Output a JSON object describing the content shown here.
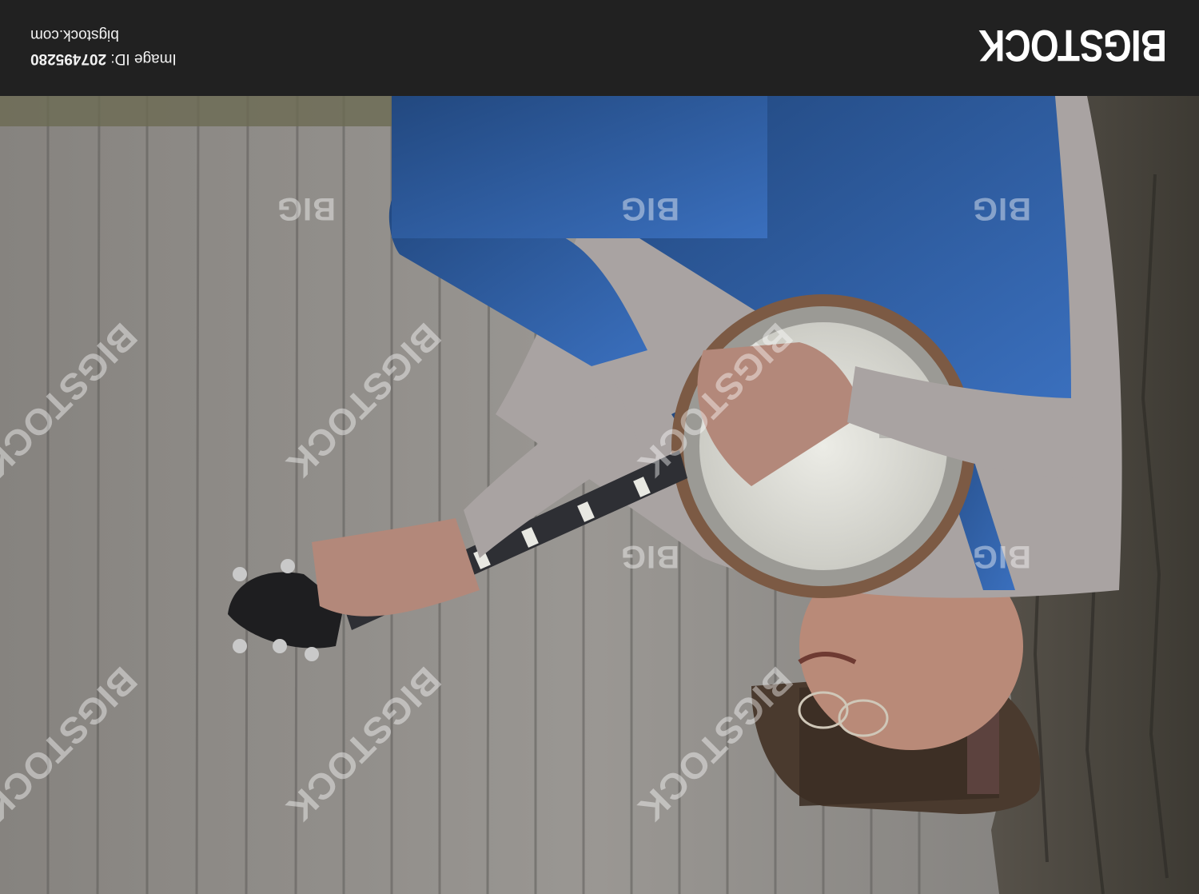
{
  "photo": {
    "subject": "man-playing-banjo"
  },
  "footer": {
    "brand": "BIGSTOCK",
    "image_id_label": "Image ID:",
    "image_id_value": "207495280",
    "site": "bigstock.com"
  },
  "watermark": {
    "large": "BIGSTOCK",
    "small": "BIG"
  },
  "colors": {
    "footer_bg": "#212121",
    "fence": "#8d8a86",
    "denim": "#2c5aa0",
    "shirt": "#a9a3a2",
    "banjo_head": "#dedfd8"
  }
}
